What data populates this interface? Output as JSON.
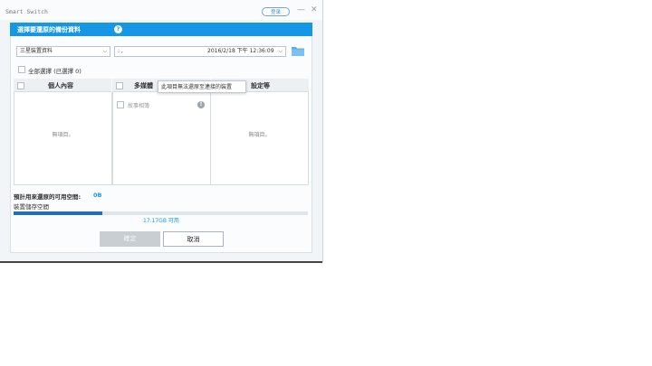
{
  "app": {
    "title": "Smart Switch",
    "login_label": "登录"
  },
  "dialog": {
    "title": "選擇要還原的備份資料",
    "device_select": "三星裝置資料",
    "backup_select_prefix": ":        ,",
    "backup_select_date": "2016/2/18 下午 12:36:09",
    "select_all_label": "全部選擇 (已選擇 0)",
    "columns": [
      {
        "title": "個人內容",
        "empty": "無項目。"
      },
      {
        "title": "多媒體"
      },
      {
        "title": "設定等",
        "empty": "無項目。"
      }
    ],
    "tooltip": "此項目無法還原至連接的裝置",
    "story_album_label": "故事相簿",
    "space_label": "預計用來還原的可用空間:",
    "space_value": "0B",
    "storage_label": "裝置儲存空間",
    "storage_available": "17.17GB 可用",
    "storage_used_fraction": 0.3,
    "ok_button": "確定",
    "cancel_button": "取消"
  },
  "colors": {
    "accent": "#1597e5",
    "bar": "#1f6fb2"
  }
}
